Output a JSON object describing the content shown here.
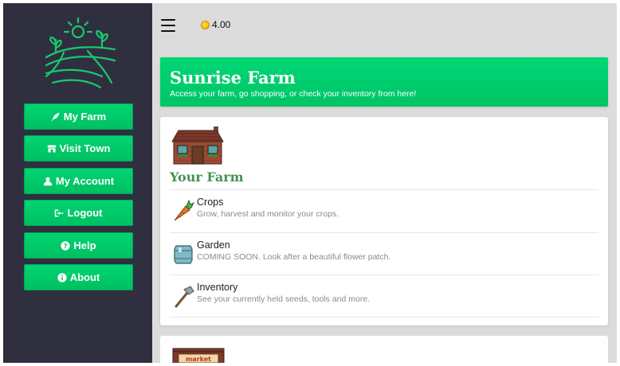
{
  "wallet": {
    "balance": "4.00",
    "coin_icon": "coin-icon"
  },
  "sidebar": {
    "logo_icon": "farm-fields-sun-logo",
    "items": [
      {
        "label": "My Farm",
        "icon": "feather-icon"
      },
      {
        "label": "Visit Town",
        "icon": "store-icon"
      },
      {
        "label": "My Account",
        "icon": "user-icon"
      },
      {
        "label": "Logout",
        "icon": "sign-out-icon"
      },
      {
        "label": "Help",
        "icon": "question-circle-icon"
      },
      {
        "label": "About",
        "icon": "info-circle-icon"
      }
    ]
  },
  "hero": {
    "title": "Sunrise Farm",
    "subtitle": "Access your farm, go shopping, or check your inventory from here!"
  },
  "farm_card": {
    "title": "Your Farm",
    "items": [
      {
        "label": "Crops",
        "description": "Grow, harvest and monitor your crops.",
        "icon": "carrot-icon"
      },
      {
        "label": "Garden",
        "description": "COMING SOON. Look after a beautiful flower patch.",
        "icon": "barrel-icon"
      },
      {
        "label": "Inventory",
        "description": "See your currently held seeds, tools and more.",
        "icon": "hoe-icon"
      }
    ]
  },
  "market_card": {
    "sign_text": "market"
  },
  "colors": {
    "sidebar_bg": "#2f2f40",
    "accent_green": "#00cc6a",
    "title_green": "#4a8f55",
    "page_bg": "#dcdcdc"
  }
}
